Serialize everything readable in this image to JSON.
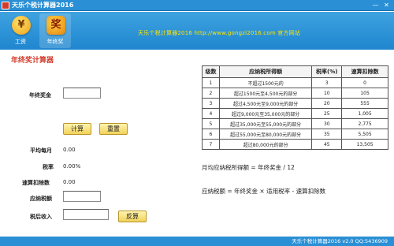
{
  "window": {
    "title": "天乐个税计算器2016",
    "minimize_glyph": "—",
    "close_glyph": "✕"
  },
  "toolbar": {
    "items": [
      {
        "label": "工资",
        "icon": "yen-icon",
        "glyph": "¥"
      },
      {
        "label": "年终奖",
        "icon": "bonus-icon",
        "glyph": "奖"
      }
    ],
    "active": "年终奖"
  },
  "banner": "天乐个税计算器2016    http://www.gongzi2016.com  官方网站",
  "form": {
    "title": "年终奖计算器",
    "bonus_label": "年终奖金",
    "bonus_value": "",
    "calc_button": "计算",
    "reset_button": "重置",
    "monthly_avg_label": "平均每月",
    "monthly_avg_value": "0.00",
    "tax_rate_label": "税率",
    "tax_rate_value": "0.00%",
    "quick_deduction_label": "速算扣除数",
    "quick_deduction_value": "0.00",
    "tax_payable_label": "应纳税额",
    "tax_payable_value": "",
    "after_tax_label": "税后收入",
    "after_tax_value": "",
    "reverse_button": "反算"
  },
  "table": {
    "headers": [
      "级数",
      "应纳税所得额",
      "税率(%)",
      "速算扣除数"
    ],
    "rows": [
      [
        "1",
        "不超过1500元的",
        "3",
        "0"
      ],
      [
        "2",
        "超过1500元至4,500元的部分",
        "10",
        "105"
      ],
      [
        "3",
        "超过4,500元至9,000元的部分",
        "20",
        "555"
      ],
      [
        "4",
        "超过9,000元至35,000元的部分",
        "25",
        "1,005"
      ],
      [
        "5",
        "超过35,000元至55,000元的部分",
        "30",
        "2,775"
      ],
      [
        "6",
        "超过55,000元至80,000元的部分",
        "35",
        "5,505"
      ],
      [
        "7",
        "超过80,000元的部分",
        "45",
        "13,505"
      ]
    ]
  },
  "formulas": {
    "monthly": "月均应纳税所得额 = 年终奖金 / 12",
    "tax": "应纳税额 = 年终奖金 × 适用税率 - 速算扣除数"
  },
  "status": "天乐个税计算器2016 v2.0   QQ:5436909"
}
